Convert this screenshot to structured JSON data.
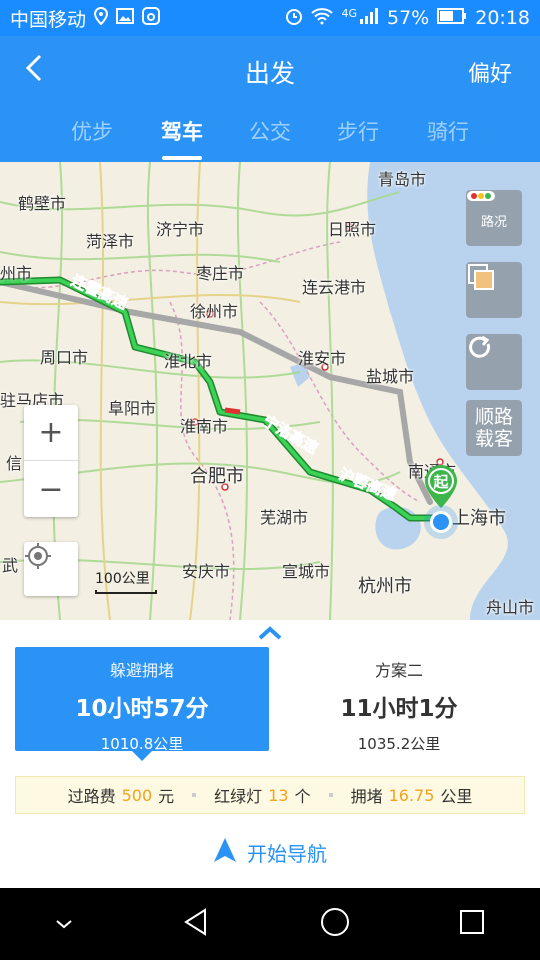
{
  "status_bar": {
    "carrier": "中国移动",
    "network": "4G",
    "battery": "57%",
    "time": "20:18",
    "icons": [
      "location-icon",
      "image-icon",
      "app-icon",
      "alarm-icon",
      "wifi-icon",
      "signal-icon",
      "battery-icon"
    ]
  },
  "header": {
    "title": "出发",
    "preferences": "偏好"
  },
  "tabs": [
    {
      "label": "优步"
    },
    {
      "label": "驾车",
      "active": true
    },
    {
      "label": "公交"
    },
    {
      "label": "步行"
    },
    {
      "label": "骑行"
    }
  ],
  "map": {
    "cities": [
      "青岛市",
      "鹤壁市",
      "菏泽市",
      "济宁市",
      "日照市",
      "州市",
      "枣庄市",
      "连云港市",
      "徐州市",
      "周口市",
      "淮北市",
      "淮安市",
      "盐城市",
      "驻马店市",
      "阜阳市",
      "淮南市",
      "信",
      "合肥市",
      "南通市",
      "芜湖市",
      "上海市",
      "武",
      "安庆市",
      "宣城市",
      "杭州市",
      "舟山市"
    ],
    "road_labels": [
      "连霍高速",
      "宁洛高速",
      "沪蓉高速"
    ],
    "traffic_button": "路况",
    "carpool_button": "顺路载客",
    "start_marker": "起",
    "scale": "100公里"
  },
  "plans": [
    {
      "name": "躲避拥堵",
      "time": "10小时57分",
      "distance": "1010.8公里",
      "selected": true
    },
    {
      "name": "方案二",
      "time": "11小时1分",
      "distance": "1035.2公里",
      "selected": false
    }
  ],
  "info": {
    "toll_label": "过路费",
    "toll_value": "500",
    "toll_unit": "元",
    "lights_label": "红绿灯",
    "lights_value": "13",
    "lights_unit": "个",
    "jam_label": "拥堵",
    "jam_value": "16.75",
    "jam_unit": "公里"
  },
  "start_navigation": "开始导航",
  "colors": {
    "accent": "#2a93f5",
    "route": "#22b14c",
    "highlight": "#f4a21d"
  }
}
